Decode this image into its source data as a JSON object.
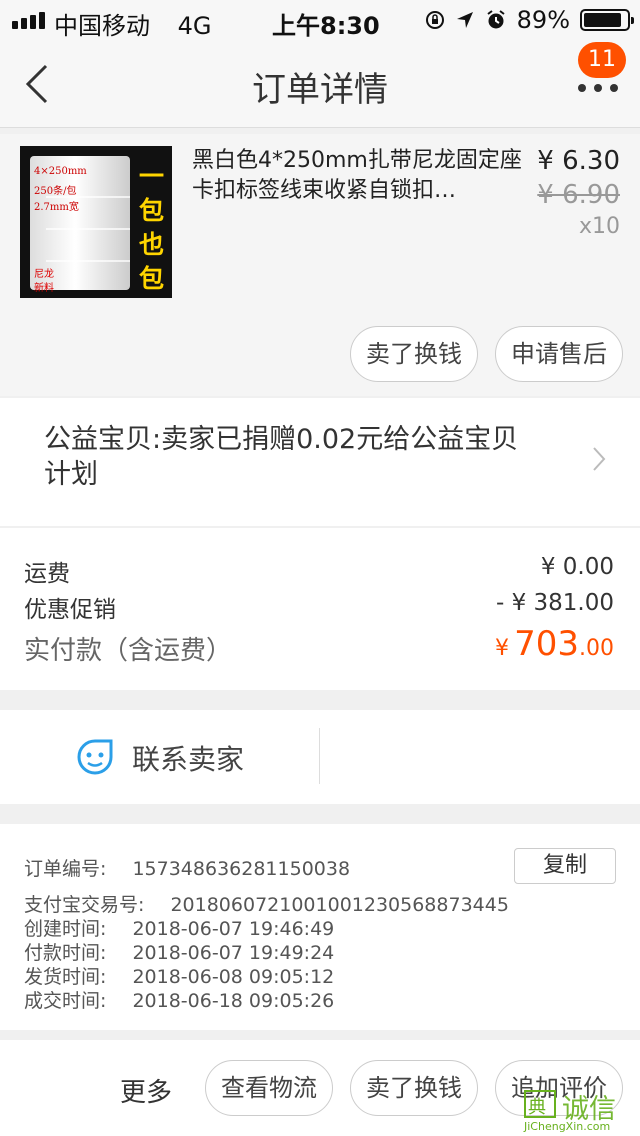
{
  "status_bar": {
    "carrier": "中国移动",
    "network": "4G",
    "time": "上午8:30",
    "battery": "89%"
  },
  "nav": {
    "title": "订单详情",
    "badge": "11"
  },
  "product": {
    "name": "黑白色4*250mm扎带尼龙固定座卡扣标签线束收紧自锁扣…",
    "price": "¥ 6.30",
    "original_price": "¥ 6.90",
    "quantity": "x10",
    "thumbnail": {
      "size": "4×250mm",
      "count": "250条/包",
      "width": "2.7mm宽",
      "promo": "一包也包邮",
      "material": "尼龙新料"
    },
    "sell_button": "卖了换钱",
    "after_sale_button": "申请售后"
  },
  "charity": {
    "text": "公益宝贝:卖家已捐赠0.02元给公益宝贝计划"
  },
  "fees": {
    "shipping_label": "运费",
    "shipping_value": "¥ 0.00",
    "discount_label": "优惠促销",
    "discount_value": "- ¥ 381.00",
    "paid_label": "实付款（含运费）",
    "paid_symbol": "¥",
    "paid_integer": "703",
    "paid_decimal": ".00"
  },
  "contact": {
    "label": "联系卖家"
  },
  "order_info": {
    "order_no_label": "订单编号:",
    "order_no": "157348636281150038",
    "copy_button": "复制",
    "alipay_label": "支付宝交易号:",
    "alipay_no": "2018060721001001230568873445",
    "created_label": "创建时间:",
    "created_time": "2018-06-07 19:46:49",
    "paid_label": "付款时间:",
    "paid_time": "2018-06-07 19:49:24",
    "shipped_label": "发货时间:",
    "shipped_time": "2018-06-08 09:05:12",
    "completed_label": "成交时间:",
    "completed_time": "2018-06-18 09:05:26"
  },
  "footer": {
    "more": "更多",
    "logistics": "查看物流",
    "sell": "卖了换钱",
    "review": "追加评价"
  },
  "watermark": {
    "box": "典",
    "text": "诚信",
    "url": "JiChengXin.com"
  },
  "colors": {
    "accent": "#ff5000",
    "watermark": "#68b11e"
  }
}
